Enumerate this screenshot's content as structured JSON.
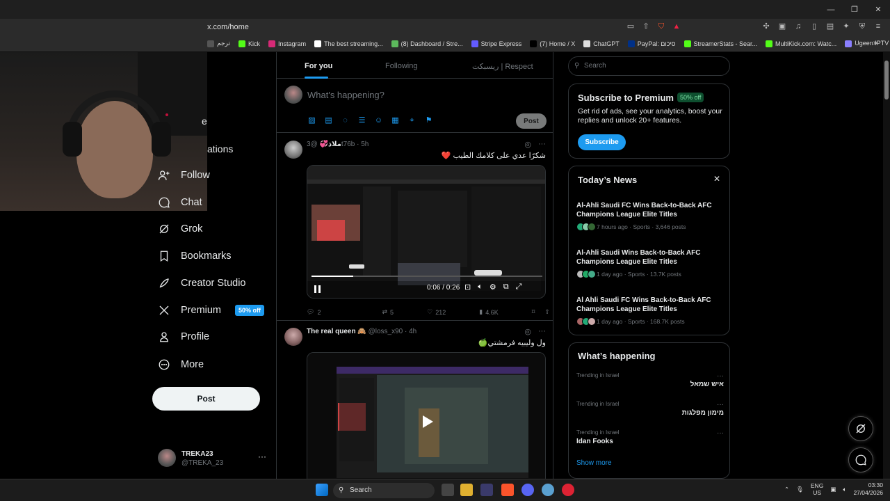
{
  "browser": {
    "url": "x.com/home",
    "bookmarks": [
      {
        "label": "ترجم",
        "color": "#555"
      },
      {
        "label": "Kick",
        "color": "#53fc18"
      },
      {
        "label": "Instagram",
        "color": "#d62976"
      },
      {
        "label": "The best streaming...",
        "color": "#fff"
      },
      {
        "label": "(8) Dashboard / Stre...",
        "color": "#5cb85c"
      },
      {
        "label": "Stripe Express",
        "color": "#635bff"
      },
      {
        "label": "(7) Home / X",
        "color": "#000"
      },
      {
        "label": "ChatGPT",
        "color": "#ddd"
      },
      {
        "label": "PayPal: סיכום",
        "color": "#003087"
      },
      {
        "label": "StreamerStats - Sear...",
        "color": "#53fc18"
      },
      {
        "label": "MultiKick.com: Watc...",
        "color": "#53fc18"
      },
      {
        "label": "Ugeen IPTV | تسجيل...",
        "color": "#8a7fff"
      }
    ]
  },
  "sidenav": {
    "partial_home": "e",
    "partial_notifications": "ations",
    "items": [
      {
        "label": "Follow",
        "icon": "follow-icon"
      },
      {
        "label": "Chat",
        "icon": "chat-icon"
      },
      {
        "label": "Grok",
        "icon": "grok-icon"
      },
      {
        "label": "Bookmarks",
        "icon": "bookmark-icon"
      },
      {
        "label": "Creator Studio",
        "icon": "rocket-icon"
      },
      {
        "label": "Premium",
        "icon": "x-logo-icon"
      },
      {
        "label": "Profile",
        "icon": "person-icon"
      },
      {
        "label": "More",
        "icon": "more-circle-icon"
      }
    ],
    "premium_badge": "50% off",
    "post_label": "Post",
    "account_name": "TREKA23",
    "account_handle": "@TREKA_23",
    "account_more": "···"
  },
  "feed": {
    "tabs": [
      "For you",
      "Following",
      "ريسبكت | Respect"
    ],
    "composer_placeholder": "What's happening?",
    "composer_post": "Post",
    "tweets": [
      {
        "name": "ملاذ💞",
        "handle": "@3t76b",
        "time": "5h",
        "text": "شكرًا عدي على كلامك الطيب ❤️",
        "video_time": "0:06 / 0:26",
        "replies": "2",
        "reposts": "5",
        "likes": "212",
        "views": "4.6K"
      },
      {
        "name": "The real queen 🙈",
        "handle": "@loss_x90",
        "time": "4h",
        "text": "ول وليبيه فرمشتي🍏"
      }
    ]
  },
  "right": {
    "search_placeholder": "Search",
    "premium": {
      "title": "Subscribe to Premium",
      "badge": "50% off",
      "text": "Get rid of ads, see your analytics, boost your replies and unlock 20+ features.",
      "button": "Subscribe"
    },
    "news": {
      "title": "Today’s News",
      "items": [
        {
          "title": "Al-Ahli Saudi FC Wins Back-to-Back AFC Champions League Elite Titles",
          "meta": "7 hours ago · Sports · 3,646 posts"
        },
        {
          "title": "Al-Ahli Saudi Wins Back-to-Back AFC Champions League Elite Titles",
          "meta": "1 day ago · Sports · 13.7K posts"
        },
        {
          "title": "Al Ahli Saudi FC Wins Back-to-Back AFC Champions League Elite Titles",
          "meta": "1 day ago · Sports · 168.7K posts"
        }
      ]
    },
    "happening": {
      "title": "What’s happening",
      "trends": [
        {
          "context": "Trending in Israel",
          "name": "איש שמאל",
          "rtl": true
        },
        {
          "context": "Trending in Israel",
          "name": "מימון מפלגות",
          "rtl": true
        },
        {
          "context": "Trending in Israel",
          "name": "Idan Fooks",
          "rtl": false
        }
      ],
      "show_more": "Show more"
    }
  },
  "taskbar": {
    "search": "Search",
    "lang_top": "ENG",
    "lang_bottom": "US",
    "time": "03:30",
    "date": "27/04/2026"
  },
  "colors": {
    "accent": "#1d9bf0",
    "background": "#000000",
    "border": "#2f3336"
  }
}
